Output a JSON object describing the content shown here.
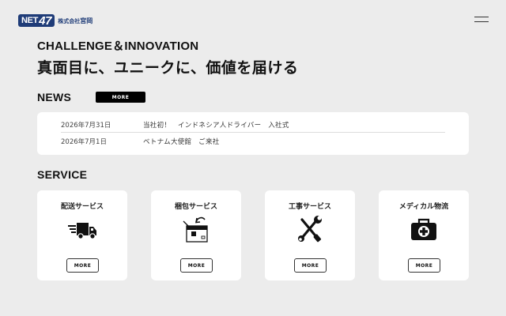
{
  "logo": {
    "badge_left": "NET",
    "badge_right": "47",
    "sub_small": "株式会社",
    "sub_big": "宮岡"
  },
  "hero": {
    "tagline": "CHALLENGE＆INNOVATION",
    "headline": "真面目に、ユニークに、価値を届ける"
  },
  "news": {
    "title": "NEWS",
    "more_label": "MORE",
    "items": [
      {
        "date": "2026年7月31日",
        "text": "当社初！　インドネシア人ドライバー　入社式"
      },
      {
        "date": "2026年7月1日",
        "text": "ベトナム大使館　ご来社"
      }
    ]
  },
  "service": {
    "title": "SERVICE",
    "items": [
      {
        "label": "配送サービス",
        "icon": "delivery-truck-icon",
        "more_label": "MORE"
      },
      {
        "label": "梱包サービス",
        "icon": "package-box-icon",
        "more_label": "MORE"
      },
      {
        "label": "工事サービス",
        "icon": "tools-icon",
        "more_label": "MORE"
      },
      {
        "label": "メディカル物流",
        "icon": "medical-kit-icon",
        "more_label": "MORE"
      }
    ]
  },
  "colors": {
    "brand": "#1f3c78",
    "background": "#ececec",
    "card": "#ffffff"
  }
}
